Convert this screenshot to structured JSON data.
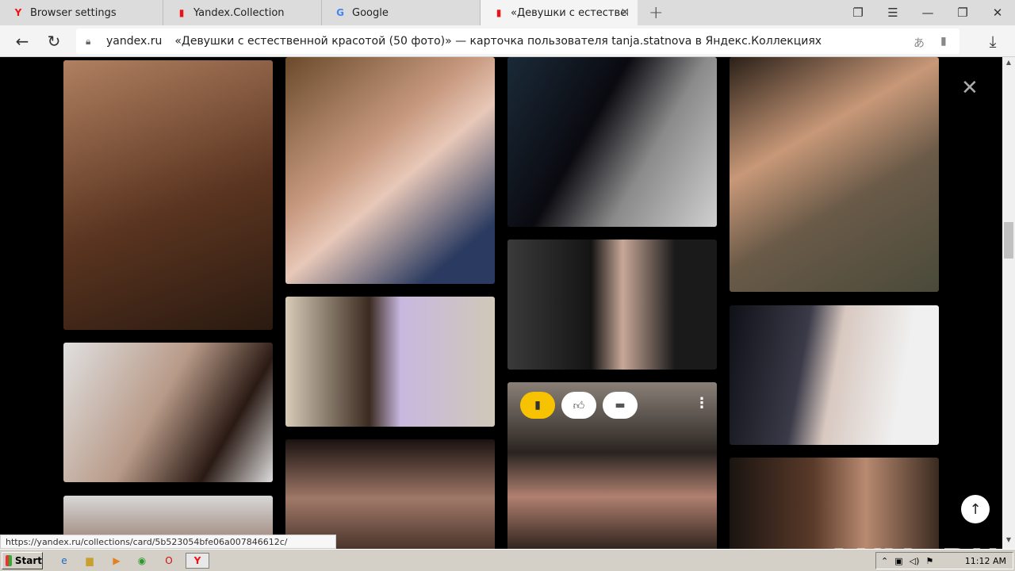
{
  "tabs": [
    {
      "label": "Browser settings",
      "icon": "yandex-icon"
    },
    {
      "label": "Yandex.Collection",
      "icon": "bookmark-icon"
    },
    {
      "label": "Google",
      "icon": "google-icon"
    },
    {
      "label": "«Девушки с естественн",
      "icon": "bookmark-icon"
    }
  ],
  "address": {
    "domain": "yandex.ru",
    "title": "«Девушки с естественной красотой (50 фото)» — карточка пользователя tanja.statnova в Яндекс.Коллекциях"
  },
  "card_actions": {
    "labels": [
      "save",
      "like",
      "comment"
    ]
  },
  "status_url": "https://yandex.ru/collections/card/5b523054bfe06a007846612c/",
  "watermark": "ANY▷RUN",
  "taskbar": {
    "start": "Start",
    "clock": "11:12 AM"
  },
  "colors": {
    "accent": "#f7c300",
    "background": "#000000"
  }
}
